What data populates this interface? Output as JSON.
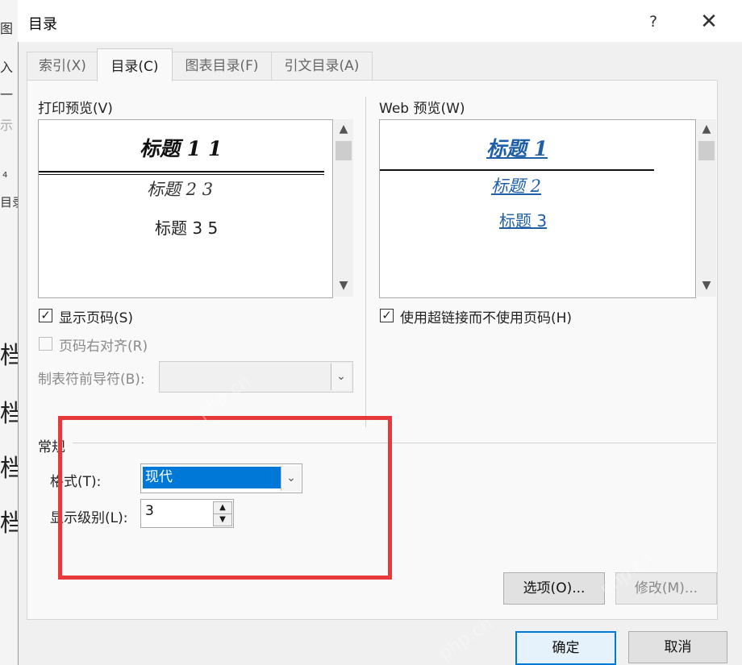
{
  "background_doc": {
    "strip_texts": [
      "图",
      "入",
      "一",
      "示",
      "4",
      "目录"
    ],
    "big_chars": [
      "档",
      "档",
      "档",
      "档"
    ]
  },
  "dialog": {
    "title": "目录",
    "help": "?",
    "close": "✕",
    "tabs": [
      {
        "label": "索引(X)",
        "active": false
      },
      {
        "label": "目录(C)",
        "active": true
      },
      {
        "label": "图表目录(F)",
        "active": false
      },
      {
        "label": "引文目录(A)",
        "active": false
      }
    ],
    "print_preview": {
      "label": "打印预览(V)",
      "h1": "标题 1",
      "h1_page": "1",
      "h2": "标题 2",
      "h2_page": "3",
      "h3": "标题 3",
      "h3_page": "5"
    },
    "web_preview": {
      "label": "Web 预览(W)",
      "h1": "标题 1",
      "h2": "标题 2",
      "h3": "标题 3"
    },
    "show_page_numbers": {
      "label": "显示页码(S)",
      "checked": true
    },
    "right_align": {
      "label": "页码右对齐(R)",
      "checked": false,
      "disabled": true
    },
    "tab_leader": {
      "label": "制表符前导符(B):",
      "value": "",
      "disabled": true
    },
    "use_hyperlinks": {
      "label": "使用超链接而不使用页码(H)",
      "checked": true
    },
    "general": {
      "label": "常规",
      "format_label": "格式(T):",
      "format_value": "现代",
      "levels_label": "显示级别(L):",
      "levels_value": "3"
    },
    "buttons": {
      "options": "选项(O)...",
      "modify": "修改(M)...",
      "ok": "确定",
      "cancel": "取消"
    },
    "watermark": "php.cn",
    "highlight_color": "#e8393a",
    "accent_color": "#0078d7"
  }
}
